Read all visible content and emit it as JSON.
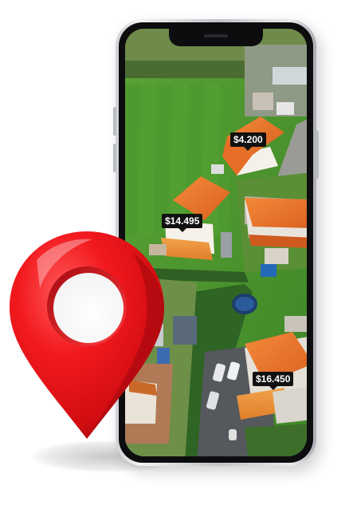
{
  "price_tags": [
    {
      "label": "$4.200"
    },
    {
      "label": "$14.495"
    },
    {
      "label": "$16.450"
    }
  ],
  "colors": {
    "pin_red": "#e8161b",
    "pin_dark": "#a90d12",
    "roof_orange": "#f07a2a",
    "grass": "#4f9a2f",
    "tag_bg": "#111111"
  },
  "icons": {
    "pin": "map-pin-icon"
  }
}
